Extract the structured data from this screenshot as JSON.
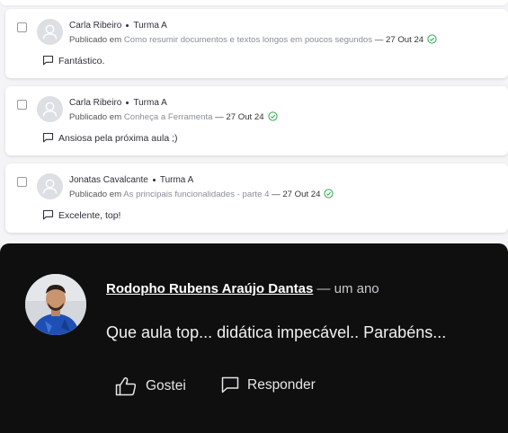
{
  "comments": [
    {
      "author": "Carla Ribeiro",
      "class_name": "Turma A",
      "published_prefix": "Publicado em",
      "lesson_link": "Como resumir documentos e textos longos em poucos segundos",
      "date_suffix": "— 27 Out 24",
      "text": "Fantástico."
    },
    {
      "author": "Carla Ribeiro",
      "class_name": "Turma A",
      "published_prefix": "Publicado em",
      "lesson_link": "Conheça a Ferramenta",
      "date_suffix": "— 27 Out 24",
      "text": "Ansiosa pela próxima aula ;)"
    },
    {
      "author": "Jonatas Cavalcante",
      "class_name": "Turma A",
      "published_prefix": "Publicado em",
      "lesson_link": "As principais funcionalidades - parte 4",
      "date_suffix": "— 27 Out 24",
      "text": "Excelente, top!"
    }
  ],
  "featured": {
    "author": "Rodopho Rubens Araújo Dantas",
    "time": "— um ano",
    "text": "Que aula top... didática impecável.. Parabéns...",
    "like_label": "Gostei",
    "reply_label": "Responder"
  },
  "icons": {
    "check": "check-circle-icon",
    "comment": "speech-bubble-icon",
    "like": "thumbs-up-icon",
    "avatar_placeholder": "user-silhouette-icon"
  },
  "colors": {
    "accent_green": "#2fa84f",
    "dark_panel": "#0f0f10",
    "link_gray": "#8a8e99"
  }
}
